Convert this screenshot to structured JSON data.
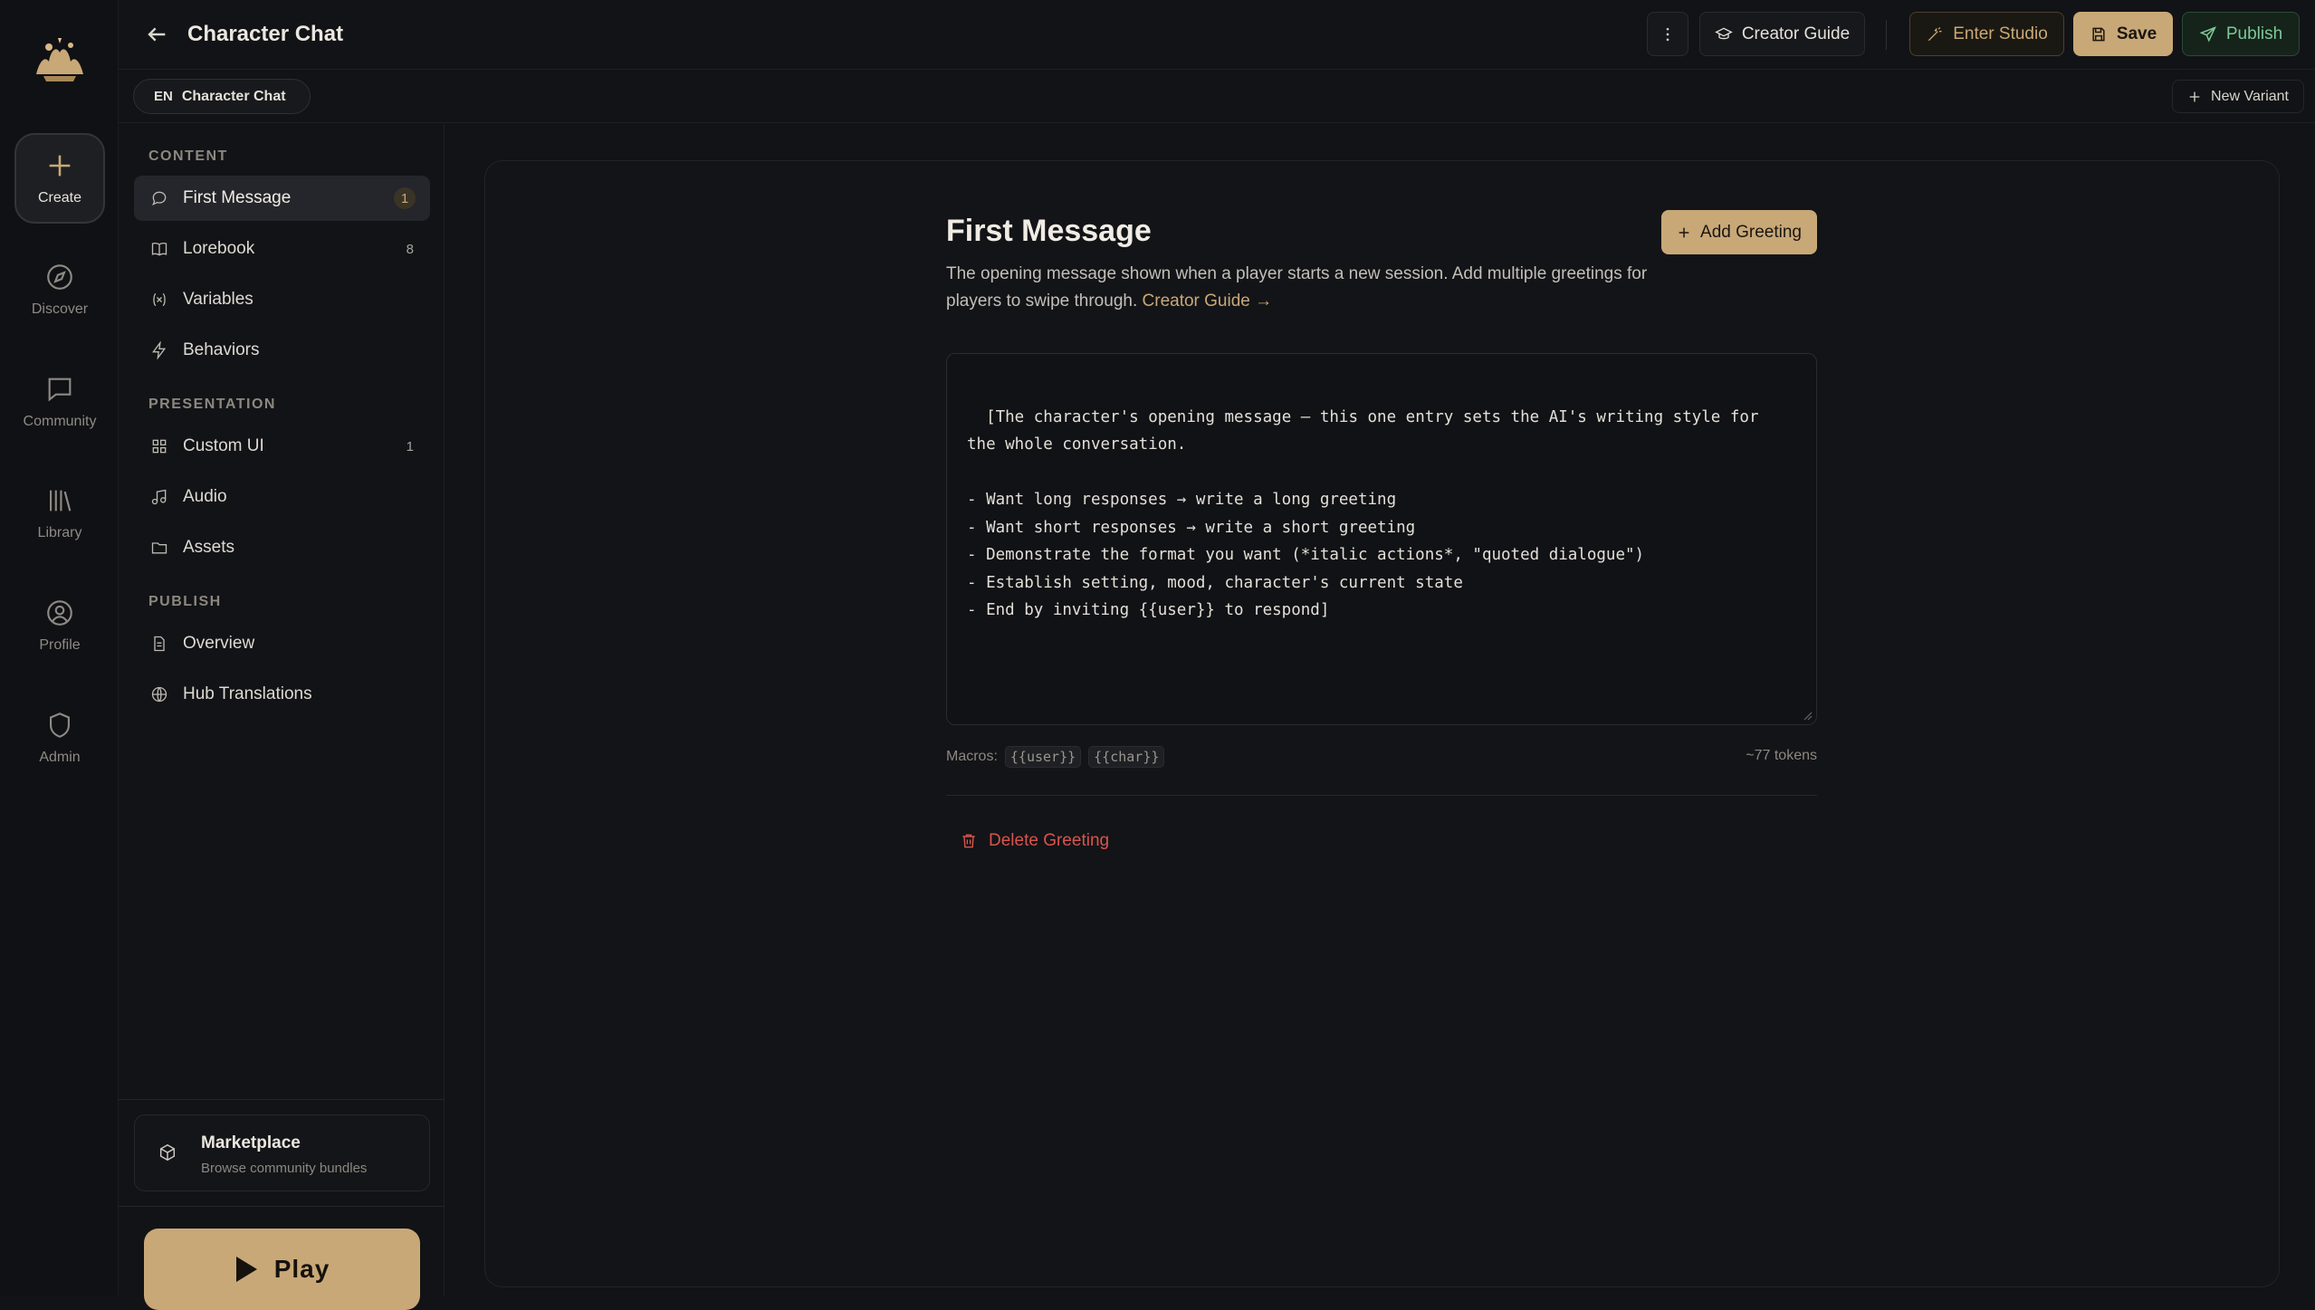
{
  "rail": {
    "items": [
      {
        "label": "Create",
        "icon": "plus-icon"
      },
      {
        "label": "Discover",
        "icon": "compass-icon"
      },
      {
        "label": "Community",
        "icon": "chat-bubble-icon"
      },
      {
        "label": "Library",
        "icon": "library-icon"
      },
      {
        "label": "Profile",
        "icon": "user-circle-icon"
      },
      {
        "label": "Admin",
        "icon": "shield-icon"
      }
    ]
  },
  "header": {
    "title": "Character Chat",
    "creator_guide": "Creator Guide",
    "enter_studio": "Enter Studio",
    "save": "Save",
    "publish": "Publish"
  },
  "subbar": {
    "lang_code": "EN",
    "variant_name": "Character Chat",
    "new_variant": "New Variant"
  },
  "sidebar": {
    "content_heading": "CONTENT",
    "content_items": [
      {
        "label": "First Message",
        "count": "1",
        "icon": "message-icon"
      },
      {
        "label": "Lorebook",
        "count": "8",
        "icon": "book-icon"
      },
      {
        "label": "Variables",
        "count": "",
        "icon": "variable-icon"
      },
      {
        "label": "Behaviors",
        "count": "",
        "icon": "lightning-icon"
      }
    ],
    "presentation_heading": "PRESENTATION",
    "presentation_items": [
      {
        "label": "Custom UI",
        "count": "1",
        "icon": "grid-icon"
      },
      {
        "label": "Audio",
        "count": "",
        "icon": "music-icon"
      },
      {
        "label": "Assets",
        "count": "",
        "icon": "folder-icon"
      }
    ],
    "publish_heading": "PUBLISH",
    "publish_items": [
      {
        "label": "Overview",
        "icon": "document-icon"
      },
      {
        "label": "Hub Translations",
        "icon": "globe-icon"
      }
    ],
    "marketplace": {
      "title": "Marketplace",
      "subtitle": "Browse community bundles"
    },
    "play": "Play"
  },
  "main": {
    "title": "First Message",
    "description": "The opening message shown when a player starts a new session. Add multiple greetings for players to swipe through.",
    "guide_link": "Creator Guide →",
    "add_greeting": "Add Greeting",
    "editor_text": "[The character's opening message — this one entry sets the AI's writing style for the whole conversation.\n\n- Want long responses → write a long greeting\n- Want short responses → write a short greeting\n- Demonstrate the format you want (*italic actions*, \"quoted dialogue\")\n- Establish setting, mood, character's current state\n- End by inviting {{user}} to respond]",
    "macros_label": "Macros:",
    "macros": [
      "{{user}}",
      "{{char}}"
    ],
    "tokens": "~77 tokens",
    "delete_greeting": "Delete Greeting"
  },
  "colors": {
    "accent": "#c9a877",
    "publish_green": "#7fc895",
    "danger": "#d9544e",
    "background": "#121316"
  }
}
